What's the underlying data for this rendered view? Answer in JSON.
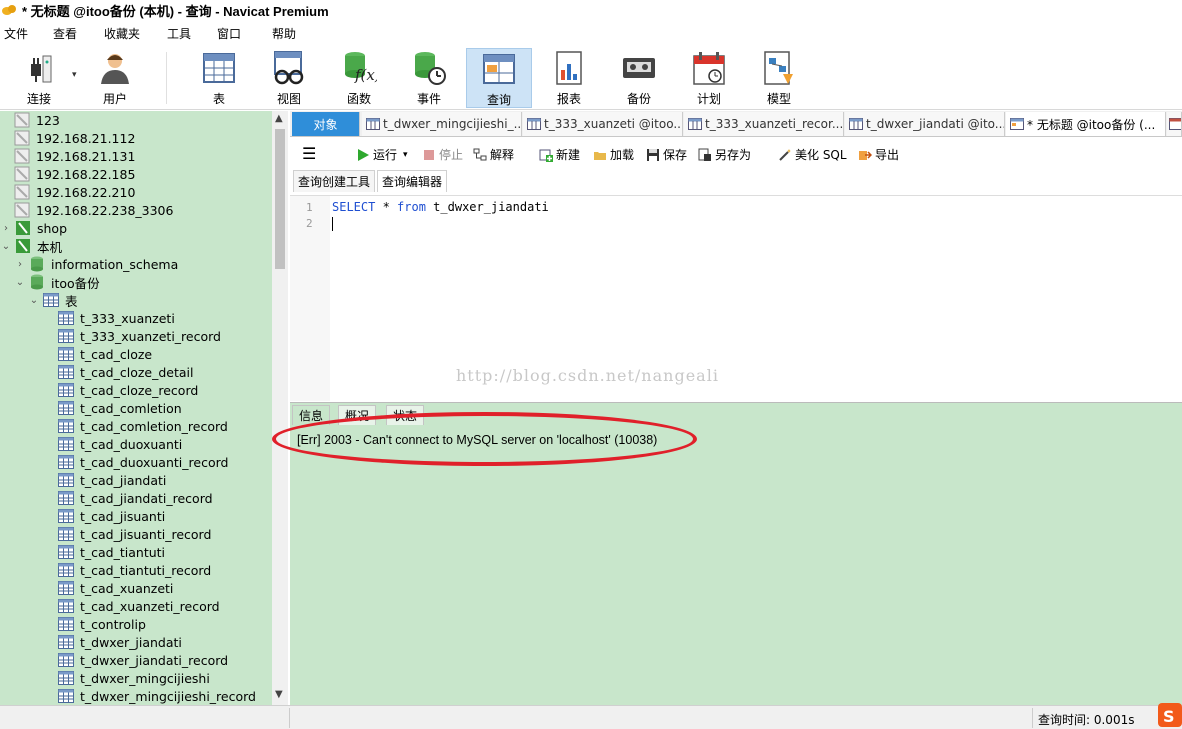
{
  "window": {
    "title": "* 无标题 @itoo备份 (本机) - 查询 - Navicat Premium"
  },
  "menu": [
    "文件",
    "查看",
    "收藏夹",
    "工具",
    "窗口",
    "帮助"
  ],
  "toolbar": {
    "connect": "连接",
    "user": "用户",
    "table": "表",
    "view": "视图",
    "function": "函数",
    "event": "事件",
    "query": "查询",
    "report": "报表",
    "backup": "备份",
    "schedule": "计划",
    "model": "模型"
  },
  "tree": {
    "connections": [
      "123",
      "192.168.21.112",
      "192.168.21.131",
      "192.168.22.185",
      "192.168.22.210",
      "192.168.22.238_3306",
      "shop",
      "本机"
    ],
    "databases": [
      "information_schema",
      "itoo备份"
    ],
    "tables_group": "表",
    "tables": [
      "t_333_xuanzeti",
      "t_333_xuanzeti_record",
      "t_cad_cloze",
      "t_cad_cloze_detail",
      "t_cad_cloze_record",
      "t_cad_comletion",
      "t_cad_comletion_record",
      "t_cad_duoxuanti",
      "t_cad_duoxuanti_record",
      "t_cad_jiandati",
      "t_cad_jiandati_record",
      "t_cad_jisuanti",
      "t_cad_jisuanti_record",
      "t_cad_tiantuti",
      "t_cad_tiantuti_record",
      "t_cad_xuanzeti",
      "t_cad_xuanzeti_record",
      "t_controlip",
      "t_dwxer_jiandati",
      "t_dwxer_jiandati_record",
      "t_dwxer_mingcijieshi",
      "t_dwxer_mingcijieshi_record"
    ]
  },
  "tabs": [
    "对象",
    "t_dwxer_mingcijieshi_...",
    "t_333_xuanzeti @itoo...",
    "t_333_xuanzeti_recor...",
    "t_dwxer_jiandati @ito...",
    "* 无标题 @itoo备份 (..."
  ],
  "query_toolbar": {
    "run": "运行",
    "stop": "停止",
    "explain": "解释",
    "new": "新建",
    "load": "加载",
    "save": "保存",
    "save_as": "另存为",
    "beautify": "美化 SQL",
    "export": "导出"
  },
  "subtabs": [
    "查询创建工具",
    "查询编辑器"
  ],
  "editor": {
    "line_numbers": [
      "1",
      "2"
    ],
    "kw_select": "SELECT",
    "star": " * ",
    "kw_from": "from",
    "table": " t_dwxer_jiandati"
  },
  "watermark": "http://blog.csdn.net/nangeali",
  "result_tabs": [
    "信息",
    "概况",
    "状态"
  ],
  "message": "[Err] 2003 - Can't connect to MySQL server on 'localhost' (10038)",
  "status": {
    "query_time": "查询时间: 0.001s"
  },
  "colors": {
    "sidebar_bg": "#c8e6cb",
    "active_tab": "#2f8ed9",
    "keyword": "#1f4fd1",
    "annotation": "#e0202a"
  }
}
